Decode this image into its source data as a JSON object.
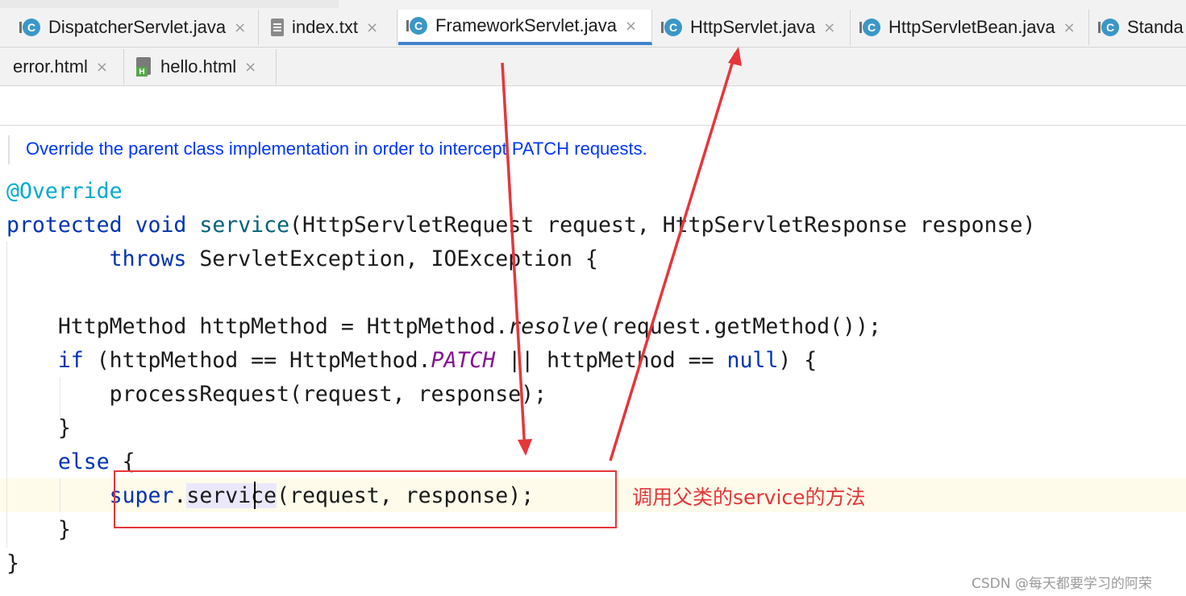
{
  "tabs_row1": [
    {
      "label": "DispatcherServlet.java",
      "icon": "class-icon",
      "close": "×"
    },
    {
      "label": "index.txt",
      "icon": "text-file-icon",
      "close": "×"
    },
    {
      "label": "FrameworkServlet.java",
      "icon": "class-icon",
      "close": "×",
      "active": true
    },
    {
      "label": "HttpServlet.java",
      "icon": "class-icon",
      "close": "×"
    },
    {
      "label": "HttpServletBean.java",
      "icon": "class-icon",
      "close": "×"
    },
    {
      "label": "Standa",
      "icon": "class-icon"
    }
  ],
  "tabs_row2": [
    {
      "label": "error.html",
      "icon": "html-file-icon",
      "close": "×"
    },
    {
      "label": "hello.html",
      "icon": "html-file-icon",
      "close": "×"
    }
  ],
  "icon_letters": {
    "class": "C",
    "html": "H"
  },
  "doc_comment": "Override the parent class implementation in order to intercept PATCH requests.",
  "code": {
    "annotation": "@Override",
    "l2_kw1": "protected",
    "l2_kw2": "void",
    "l2_fn": "service",
    "l2_rest": "(HttpServletRequest request, HttpServletResponse response)",
    "l3_kw": "throws",
    "l3_rest": " ServletException, IOException {",
    "l5_a": "HttpMethod httpMethod = HttpMethod.",
    "l5_it": "resolve",
    "l5_b": "(request.getMethod());",
    "l6_kw": "if",
    "l6_a": " (httpMethod == HttpMethod.",
    "l6_stat": "PATCH",
    "l6_b": " || httpMethod == ",
    "l6_null": "null",
    "l6_c": ") {",
    "l7": "processRequest(request, response);",
    "l8": "}",
    "l9_kw": "else",
    "l9_rest": " {",
    "l10_kw": "super",
    "l10_dot": ".",
    "l10_hl": "service",
    "l10_rest": "(request, response);",
    "l11": "}",
    "l12": "}"
  },
  "annotation_note": "调用父类的service的方法",
  "watermark": "CSDN @每天都要学习的阿荣",
  "colors": {
    "keyword": "#0033b3",
    "annotation": "#00aacc",
    "method": "#00627a",
    "static": "#871094",
    "doc": "#0036ff",
    "red": "#e5363a",
    "accent": "#4083c9"
  }
}
